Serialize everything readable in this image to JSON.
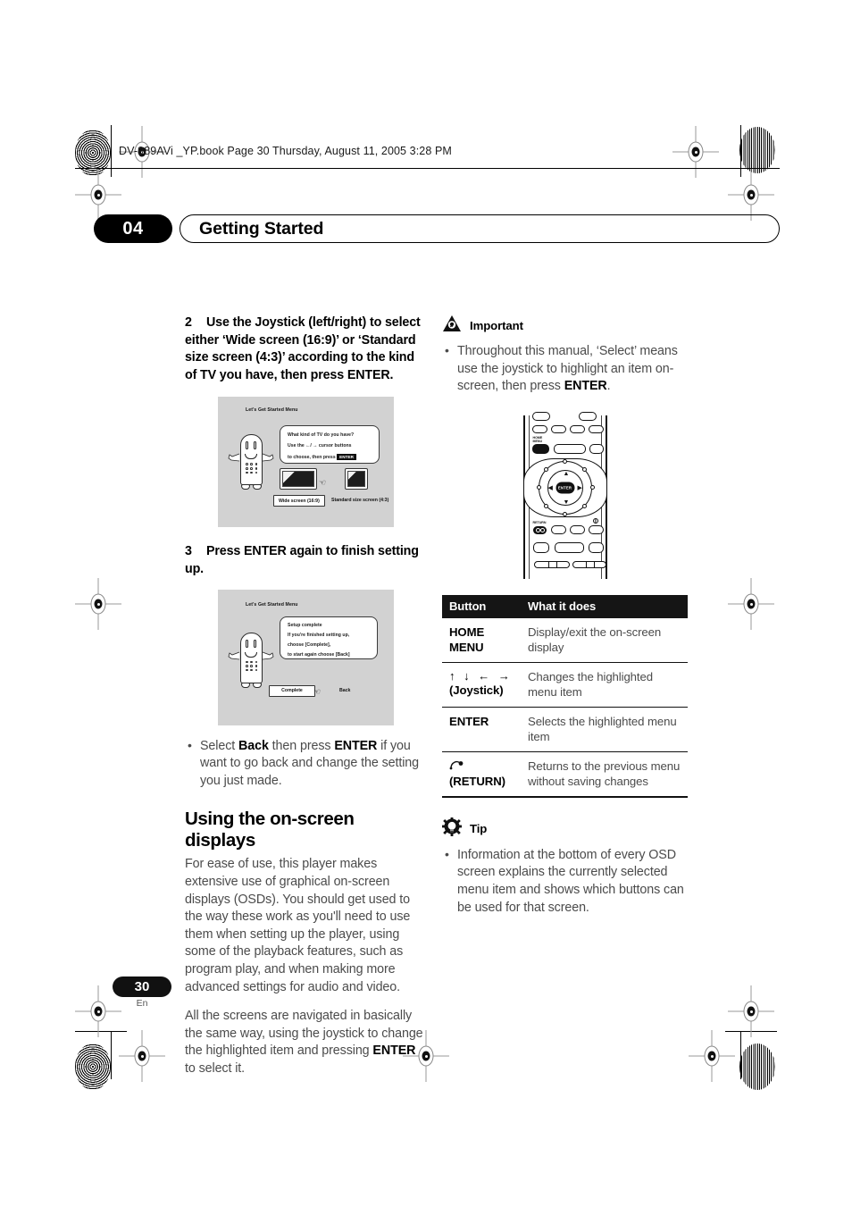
{
  "header": {
    "book_line": "DV-989AVi _YP.book  Page 30  Thursday, August 11, 2005  3:28 PM"
  },
  "chapter": {
    "number": "04",
    "title": "Getting Started"
  },
  "left_column": {
    "step2": {
      "num": "2",
      "text_html": "Use the Joystick (left/right) to select either ‘Wide screen (16:9)’ or ‘Standard size screen (4:3)’ according to the kind of TV you have, then press ENTER."
    },
    "figure1": {
      "menu_title": "Let's Get Started Menu",
      "bubble_lines": [
        "What kind of TV do you have?",
        "Use the ←/ → cursor buttons",
        "to choose, then press"
      ],
      "bubble_enter": "ENTER",
      "option_wide": "Wide screen (16:9)",
      "option_standard": "Standard size screen (4:3)"
    },
    "step3": {
      "num": "3",
      "text_html": "Press ENTER again to finish setting up."
    },
    "figure2": {
      "menu_title": "Let's Get Started Menu",
      "bubble_lines": [
        "Setup complete",
        "If you're finished setting up,",
        "choose [Complete],",
        "to start again choose [Back]"
      ],
      "option_complete": "Complete",
      "option_back": "Back"
    },
    "bullet_back": {
      "pre": "Select ",
      "b1": "Back",
      "mid": " then press ",
      "b2": "ENTER",
      "post": " if you want to go back and change the setting you just made."
    },
    "section": {
      "title": "Using the on-screen displays",
      "para1": "For ease of use, this player makes extensive use of graphical on-screen displays (OSDs). You should get used to the way these work as you'll need to use them when setting up the player, using some of the playback features, such as program play, and when making more advanced settings for audio and video.",
      "para2": {
        "pre": "All the screens are navigated in basically the same way, using the joystick to change the highlighted item and pressing ",
        "b1": "ENTER",
        "post": " to select it."
      }
    }
  },
  "right_column": {
    "important": {
      "icon": "warning-triangle-icon",
      "label": "Important",
      "bullet": {
        "pre": "Throughout this manual, ‘Select’ means use the joystick to highlight an item on-screen, then press ",
        "b1": "ENTER",
        "post": "."
      }
    },
    "remote": {
      "home_menu_label": "HOME\nMENU",
      "enter_label": "ENTER",
      "return_label": "RETURN"
    },
    "table": {
      "headers": [
        "Button",
        "What it does"
      ],
      "rows": [
        {
          "button": "HOME\nMENU",
          "button_type": "text",
          "what": "Display/exit the on-screen display"
        },
        {
          "button": "↑ ↓ ← →",
          "button_sub": "(Joystick)",
          "button_type": "arrows",
          "what": "Changes the highlighted menu item"
        },
        {
          "button": "ENTER",
          "button_type": "text",
          "what": "Selects the highlighted menu item"
        },
        {
          "button": "↺",
          "button_sub": "(RETURN)",
          "button_type": "return",
          "what": "Returns to the previous menu without saving changes"
        }
      ]
    },
    "tip": {
      "icon": "lightbulb-icon",
      "label": "Tip",
      "bullet": "Information at the bottom of every OSD screen explains the currently selected menu item and shows which buttons can be used for that screen."
    }
  },
  "footer": {
    "page_number": "30",
    "language": "En"
  },
  "colors": {
    "ink": "#000000",
    "body_gray": "#4b4b4b",
    "osd_bg": "#d2d2d2",
    "table_header_bg": "#151515"
  }
}
